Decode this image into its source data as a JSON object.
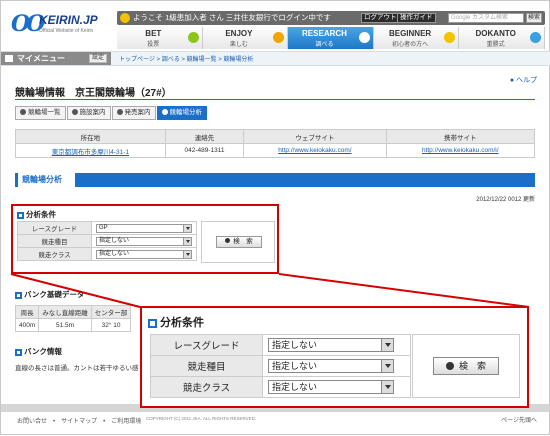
{
  "brand": {
    "logo_text": "KEIRIN.JP",
    "logo_sub": "Official Website of Keirin"
  },
  "topbar": {
    "welcome": "ようこそ 1級患加入者 さん 三井住友銀行でログイン中です",
    "logout_label": "ログアウト",
    "guide_label": "操作ガイド",
    "search_placeholder": "Google カスタム検索",
    "search_button": "検索"
  },
  "nav": [
    {
      "title": "BET",
      "sub": "投票",
      "color": "#8fc41f"
    },
    {
      "title": "ENJOY",
      "sub": "楽しむ",
      "color": "#f2a400"
    },
    {
      "title": "RESEARCH",
      "sub": "調べる",
      "color": "#1e78c6"
    },
    {
      "title": "BEGINNER",
      "sub": "初心者の方へ",
      "color": "#f2c400"
    },
    {
      "title": "DOKANTO",
      "sub": "重勝式",
      "color": "#3aa0e0"
    }
  ],
  "menubar": {
    "my_menu": "マイメニュー",
    "settings": "設定",
    "breadcrumb": "トップページ  >  調べる  >  競輪場一覧  >  競輪場分析"
  },
  "page": {
    "help": "ヘルプ",
    "title": "競輪場情報　京王閣競輪場（27#）",
    "subtabs": [
      {
        "label": "競輪場一覧",
        "active": false
      },
      {
        "label": "施設案内",
        "active": false
      },
      {
        "label": "発売案内",
        "active": false
      },
      {
        "label": "競輪場分析",
        "active": true
      }
    ],
    "info_headers": [
      "所在地",
      "連絡先",
      "ウェブサイト",
      "携帯サイト"
    ],
    "info_row": [
      "東京都調布市多摩川4-31-1",
      "042-489-1311",
      "http://www.keiokaku.com/",
      "http://www.keiokaku.com/i/"
    ],
    "section_title": "競輪場分析",
    "updated": "2012/12/22 0012 更新"
  },
  "analysis": {
    "title": "分析条件",
    "rows": [
      {
        "label": "レースグレード",
        "small_value": "GP",
        "large_value": "指定しない"
      },
      {
        "label": "競走種目",
        "small_value": "指定しない",
        "large_value": "指定しない"
      },
      {
        "label": "競走クラス",
        "small_value": "指定しない",
        "large_value": "指定しない"
      }
    ],
    "search_button": "検　索"
  },
  "bank": {
    "title": "バンク基礎データ",
    "headers": [
      "周長",
      "みなし直線距離",
      "センター部"
    ],
    "row": [
      "400m",
      "51.5m",
      "32° 10"
    ],
    "info_title": "バンク情報",
    "info_text": "直線の長さは普通。カントは若干ゆるい感"
  },
  "footer": {
    "links": "お問い合せ　•　サイトマップ　•　ご利用環境",
    "copyright": "COPYRIGHT (C) 2011 JKA. ALL RIGHTS RESERVED.",
    "top": "ページ先頭へ"
  }
}
